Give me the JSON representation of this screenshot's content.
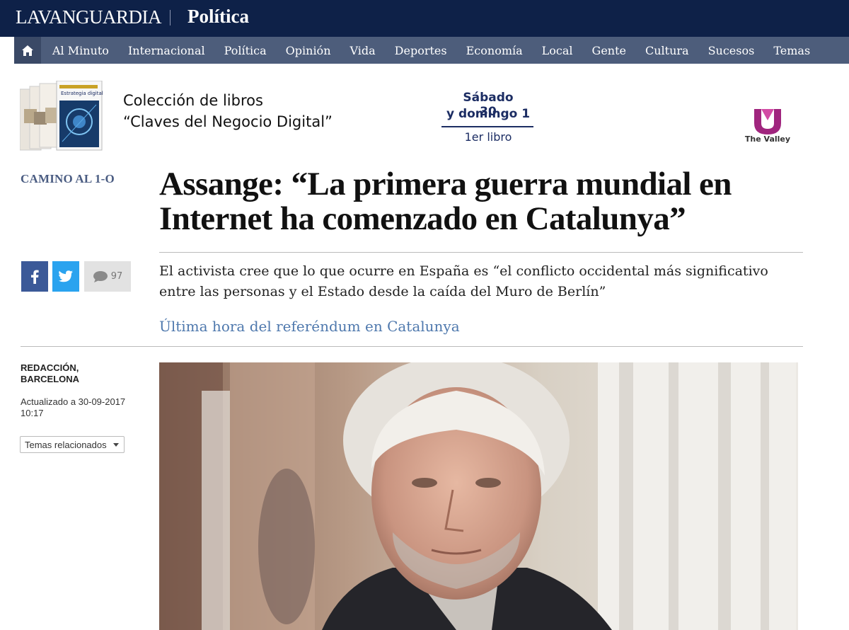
{
  "masthead": {
    "brand": "LAVANGUARDIA",
    "section": "Política"
  },
  "nav": {
    "home_icon": "home-icon",
    "items": [
      "Al Minuto",
      "Internacional",
      "Política",
      "Opinión",
      "Vida",
      "Deportes",
      "Economía",
      "Local",
      "Gente",
      "Cultura",
      "Sucesos",
      "Temas"
    ]
  },
  "ad": {
    "title_line1": "Colección de libros",
    "title_line2": "“Claves del Negocio Digital”",
    "date_line1": "Sábado 30",
    "date_line2": "y domingo 1",
    "date_line3": "1er libro",
    "sponsor": "The Valley",
    "book_cover_text": "Estrategia digital"
  },
  "article": {
    "category": "CAMINO AL 1-O",
    "headline": "Assange: “La primera guerra mundial en Internet ha comenzado en Catalunya”",
    "subtitle": "El activista cree que lo que ocurre en España es “el conflicto occidental más significativo entre las personas y el Estado desde la caída del Muro de Berlín”",
    "live_link": "Última hora del referéndum en Catalunya",
    "author": "REDACCIÓN, BARCELONA",
    "updated": "Actualizado a 30-09-2017 10:17",
    "topics_label": "Temas relacionados"
  },
  "share": {
    "comment_count": "97",
    "colors": {
      "facebook": "#3b5998",
      "twitter": "#2aa3ef"
    }
  },
  "colors": {
    "masthead": "#0e2148",
    "navbar": "#4d5d7b",
    "category": "#4a5c82",
    "link": "#4e78ad"
  }
}
